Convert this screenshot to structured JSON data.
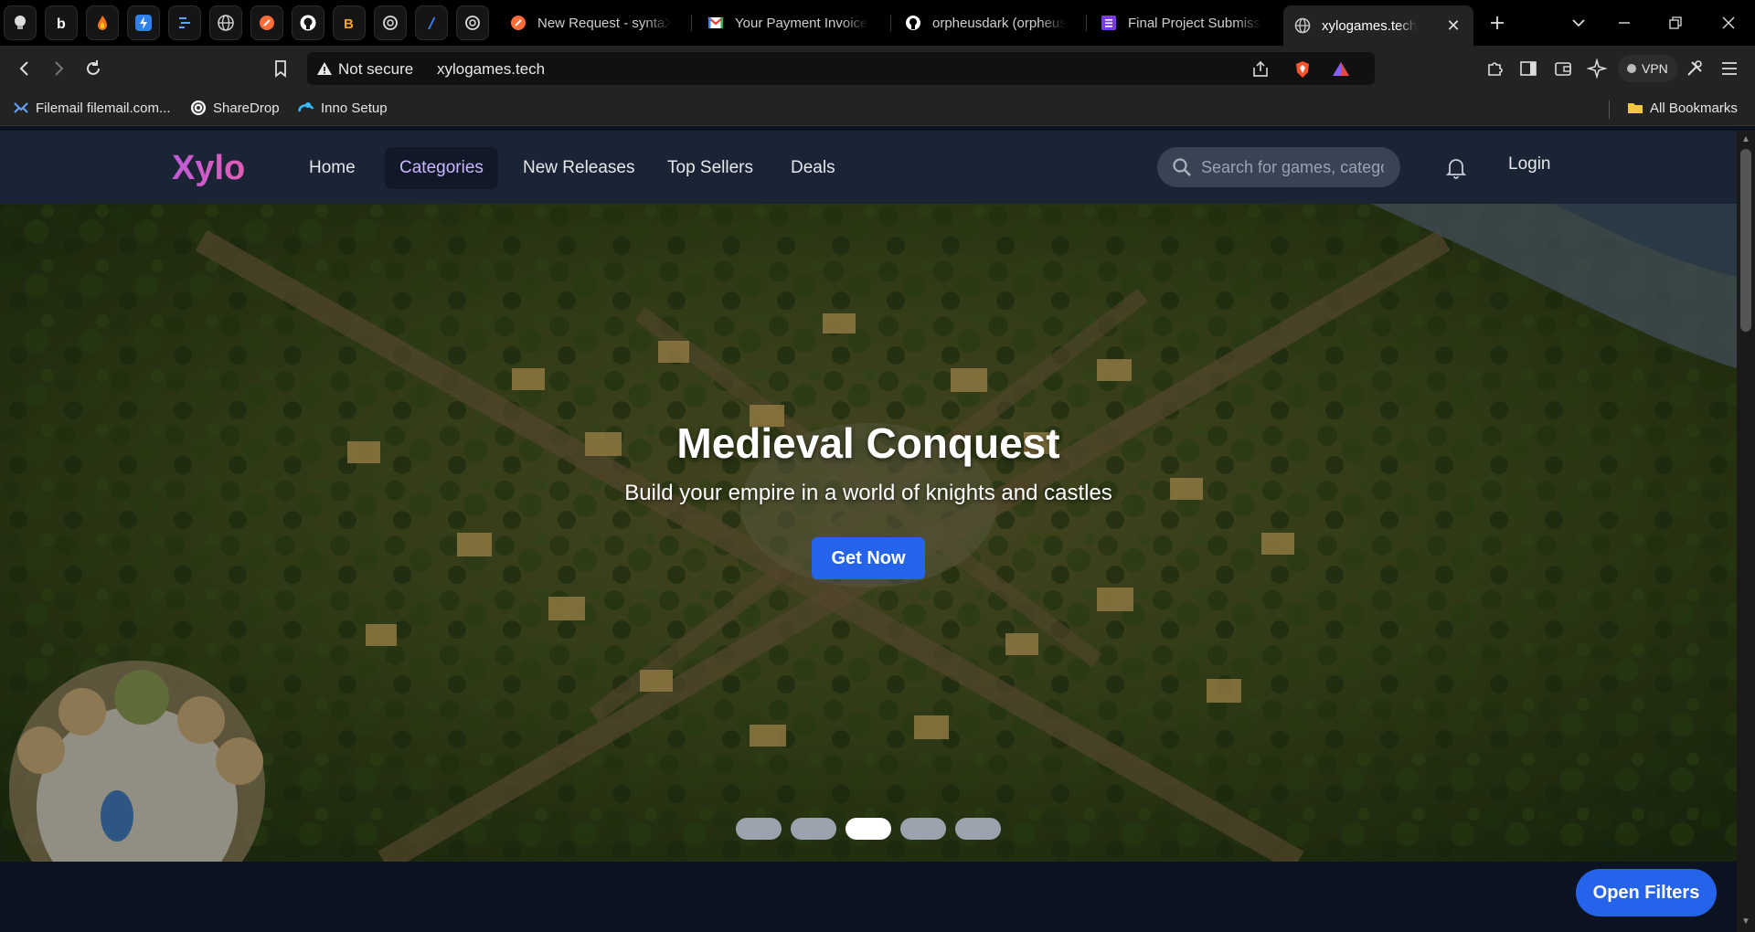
{
  "browser": {
    "pinned_tabs": [
      {
        "icon": "bulb-icon"
      },
      {
        "icon": "b-letter-icon"
      },
      {
        "icon": "flame-icon"
      },
      {
        "icon": "bolt-icon"
      },
      {
        "icon": "lines-icon"
      },
      {
        "icon": "globe-icon"
      },
      {
        "icon": "postman-icon"
      },
      {
        "icon": "github-icon"
      },
      {
        "icon": "b-coin-icon"
      },
      {
        "icon": "openai-icon"
      },
      {
        "icon": "arrow-app-icon"
      },
      {
        "icon": "openai-icon"
      }
    ],
    "tabs": [
      {
        "title": "New Request - syntaX_",
        "icon": "postman-icon"
      },
      {
        "title": "Your Payment Invoice -",
        "icon": "gmail-icon"
      },
      {
        "title": "orpheusdark (orpheusd",
        "icon": "github-icon"
      },
      {
        "title": "Final Project Submissio",
        "icon": "form-icon"
      },
      {
        "title": "xylogames.tech",
        "icon": "globe-icon",
        "active": true
      }
    ],
    "address": {
      "security": "Not secure",
      "url": "xylogames.tech"
    },
    "vpn_label": "VPN",
    "bookmarks": [
      {
        "label": "Filemail filemail.com...",
        "icon": "filemail-icon"
      },
      {
        "label": "ShareDrop",
        "icon": "sharedrop-icon"
      },
      {
        "label": "Inno Setup",
        "icon": "inno-icon"
      }
    ],
    "all_bookmarks": "All Bookmarks"
  },
  "site": {
    "logo": "Xylo",
    "nav": [
      {
        "label": "Home"
      },
      {
        "label": "Categories",
        "active": true
      },
      {
        "label": "New Releases"
      },
      {
        "label": "Top Sellers"
      },
      {
        "label": "Deals"
      }
    ],
    "search_placeholder": "Search for games, categories",
    "login": "Login"
  },
  "hero": {
    "title": "Medieval Conquest",
    "subtitle": "Build your empire in a world of knights and castles",
    "cta": "Get Now",
    "slides_total": 5,
    "active_slide": 3
  },
  "open_filters": "Open Filters",
  "colors": {
    "accent": "#2563eb",
    "logo_gradient_start": "#c05ad8",
    "nav_bg": "#1b2434",
    "page_bg": "#0b1220"
  }
}
